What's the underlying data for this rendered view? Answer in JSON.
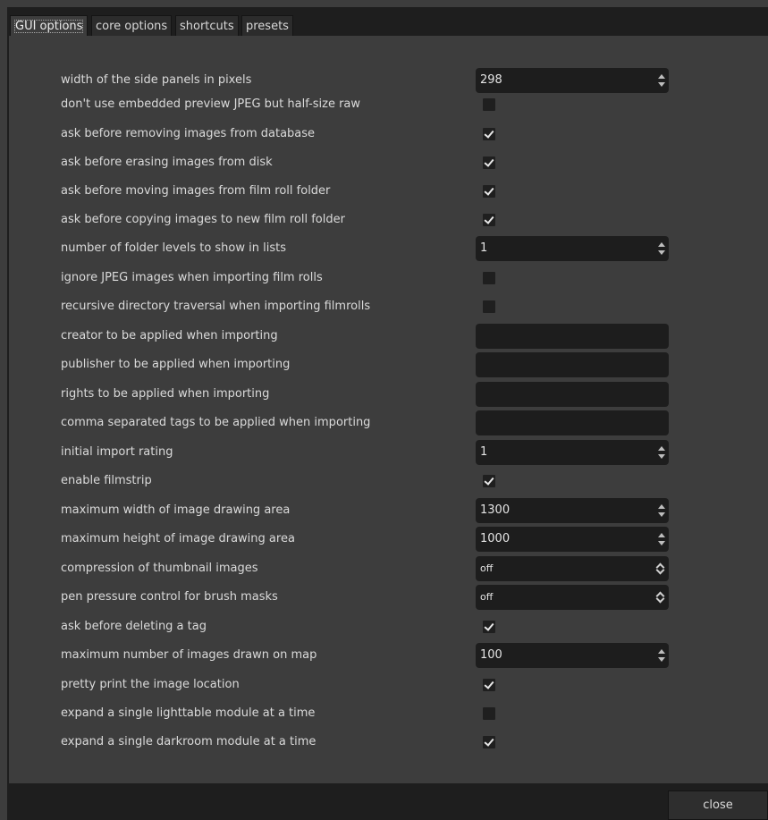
{
  "tabs": [
    {
      "label": "GUI options",
      "active": true
    },
    {
      "label": "core options",
      "active": false
    },
    {
      "label": "shortcuts",
      "active": false
    },
    {
      "label": "presets",
      "active": false
    }
  ],
  "rows": [
    {
      "label": "width of the side panels in pixels",
      "control": "spin",
      "value": "298"
    },
    {
      "label": "don't use embedded preview JPEG but half-size raw",
      "control": "checkbox",
      "checked": false
    },
    {
      "label": "ask before removing images from database",
      "control": "checkbox",
      "checked": true
    },
    {
      "label": "ask before erasing images from disk",
      "control": "checkbox",
      "checked": true
    },
    {
      "label": "ask before moving images from film roll folder",
      "control": "checkbox",
      "checked": true
    },
    {
      "label": "ask before copying images to new film roll folder",
      "control": "checkbox",
      "checked": true
    },
    {
      "label": "number of folder levels to show in lists",
      "control": "spin",
      "value": "1"
    },
    {
      "label": "ignore JPEG images when importing film rolls",
      "control": "checkbox",
      "checked": false
    },
    {
      "label": "recursive directory traversal when importing filmrolls",
      "control": "checkbox",
      "checked": false
    },
    {
      "label": "creator to be applied when importing",
      "control": "text",
      "value": ""
    },
    {
      "label": "publisher to be applied when importing",
      "control": "text",
      "value": ""
    },
    {
      "label": "rights to be applied when importing",
      "control": "text",
      "value": ""
    },
    {
      "label": "comma separated tags to be applied when importing",
      "control": "text",
      "value": ""
    },
    {
      "label": "initial import rating",
      "control": "spin",
      "value": "1"
    },
    {
      "label": "enable filmstrip",
      "control": "checkbox",
      "checked": true
    },
    {
      "label": "maximum width of image drawing area",
      "control": "spin",
      "value": "1300"
    },
    {
      "label": "maximum height of image drawing area",
      "control": "spin",
      "value": "1000"
    },
    {
      "label": "compression of thumbnail images",
      "control": "combo",
      "value": "off"
    },
    {
      "label": "pen pressure control for brush masks",
      "control": "combo",
      "value": "off"
    },
    {
      "label": "ask before deleting a tag",
      "control": "checkbox",
      "checked": true
    },
    {
      "label": "maximum number of images drawn on map",
      "control": "spin",
      "value": "100"
    },
    {
      "label": "pretty print the image location",
      "control": "checkbox",
      "checked": true
    },
    {
      "label": "expand a single lighttable module at a time",
      "control": "checkbox",
      "checked": false
    },
    {
      "label": "expand a single darkroom module at a time",
      "control": "checkbox",
      "checked": true
    }
  ],
  "footer": {
    "close_label": "close"
  },
  "icons": {
    "spin": "spin-arrows-icon",
    "combo": "combo-arrows-icon",
    "check": "checkmark-icon"
  },
  "colors": {
    "background": "#3d3d3d",
    "field": "#1d1d1d",
    "frame": "#1e1e1e",
    "text": "#dadada"
  }
}
